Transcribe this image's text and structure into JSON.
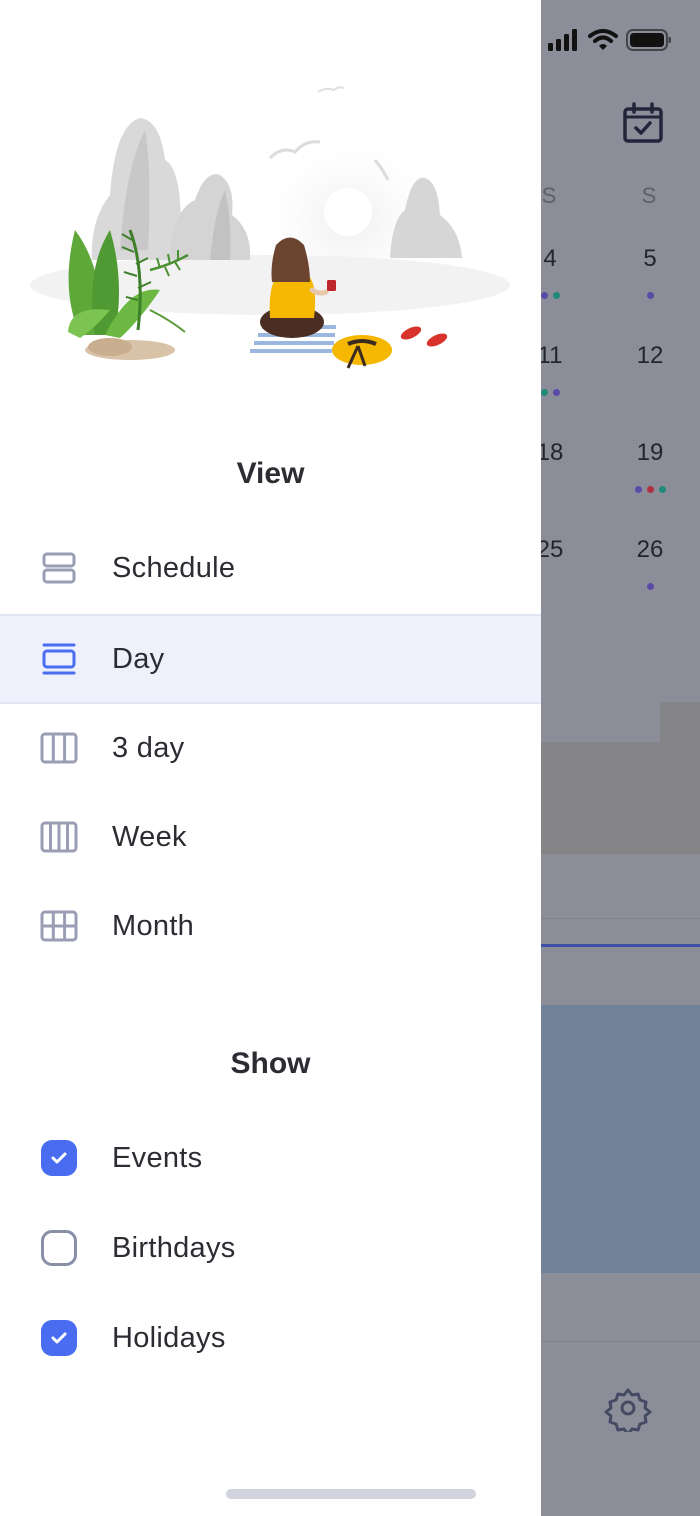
{
  "background_app": {
    "status_bar": {
      "signal_icon": "cellular-signal-icon",
      "wifi_icon": "wifi-icon",
      "battery_icon": "battery-icon"
    },
    "today_icon": "calendar-check-icon",
    "day_headers": [
      "S",
      "S"
    ],
    "calendar_rows": [
      {
        "sat": "4",
        "sun": "5",
        "sat_dots": [
          "#5b4aa8",
          "#1f8a7a"
        ],
        "sun_dots": [
          "#5b4aa8"
        ]
      },
      {
        "sat": "11",
        "sun": "12",
        "sat_dots": [
          "#1f8a7a",
          "#5b4aa8"
        ],
        "sun_dots": []
      },
      {
        "sat": "18",
        "sun": "19",
        "sat_dots": [],
        "sun_dots": [
          "#5b4aa8",
          "#b03040",
          "#1f8a7a"
        ]
      },
      {
        "sat": "25",
        "sun": "26",
        "sat_dots": [],
        "sun_dots": [
          "#5b4aa8"
        ]
      }
    ],
    "settings_icon": "gear-icon"
  },
  "drawer": {
    "illustration": "beach-relaxation-illustration",
    "view_section": {
      "title": "View",
      "items": [
        {
          "label": "Schedule",
          "icon": "schedule-view-icon",
          "selected": false
        },
        {
          "label": "Day",
          "icon": "day-view-icon",
          "selected": true
        },
        {
          "label": "3 day",
          "icon": "three-day-view-icon",
          "selected": false
        },
        {
          "label": "Week",
          "icon": "week-view-icon",
          "selected": false
        },
        {
          "label": "Month",
          "icon": "month-view-icon",
          "selected": false
        }
      ]
    },
    "show_section": {
      "title": "Show",
      "items": [
        {
          "label": "Events",
          "checked": true
        },
        {
          "label": "Birthdays",
          "checked": false
        },
        {
          "label": "Holidays",
          "checked": true
        }
      ]
    }
  },
  "colors": {
    "accent": "#4a6cf0",
    "selected_bg": "#eef0fb",
    "icon_gray": "#9a9db3",
    "text": "#2b2d33"
  }
}
